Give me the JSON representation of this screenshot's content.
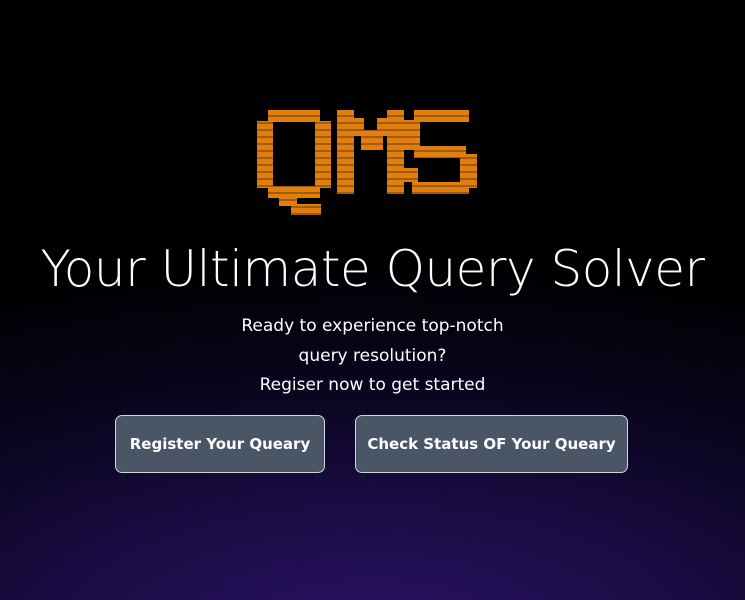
{
  "brand": {
    "logo_text": "QMS",
    "logo_color": "#e07e0e"
  },
  "hero": {
    "title": "Your Ultimate Query Solver",
    "subtitle_lines": [
      "Ready to experience top-notch",
      "query resolution?",
      "Regiser now to get started"
    ]
  },
  "actions": {
    "register_label": "Register Your Queary",
    "status_label": "Check Status OF Your Queary"
  },
  "colors": {
    "background": "#000000",
    "glow": "#2a1466",
    "button_bg": "#4a5566",
    "button_border": "#cfd6e0"
  }
}
